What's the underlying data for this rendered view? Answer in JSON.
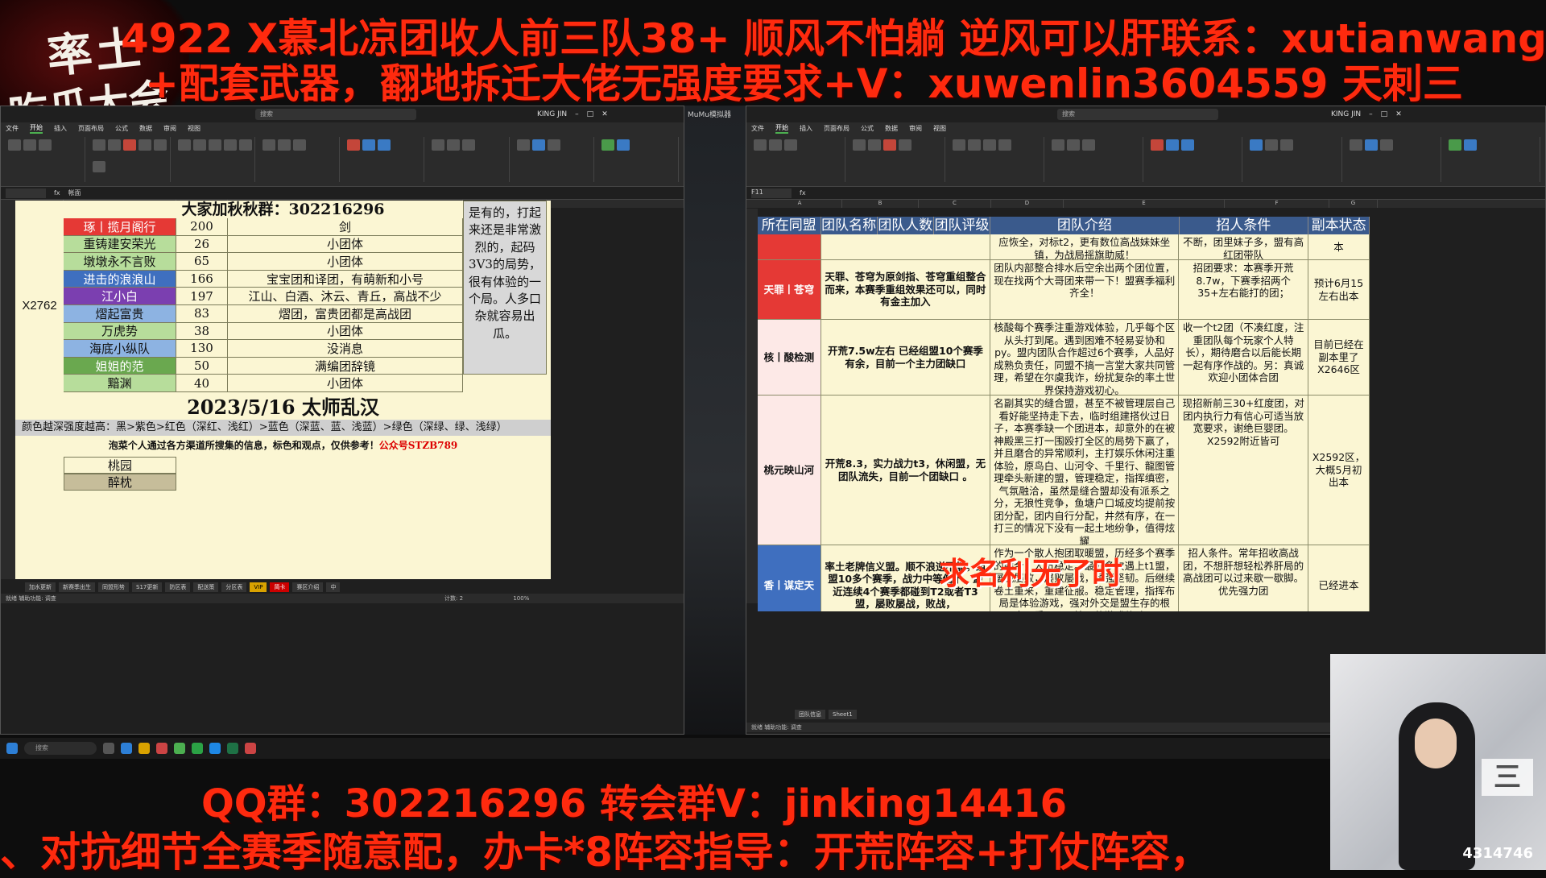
{
  "banners": {
    "top1": "4922 X慕北凉团收人前三队38+ 顺风不怕躺 逆风可以肝联系：xutianwang0",
    "top2": "+配套武器，翻地拆迁大佬无强度要求+V：xuwenlin3604559 天刺三",
    "bottom1": "QQ群：302216296 转会群V：jinking14416",
    "bottom2": "、对抗细节全赛季随意配，办卡*8阵容指导：开荒阵容+打仗阵容，",
    "logo_line1": "率土",
    "logo_line2": "吃瓜大会"
  },
  "left_window": {
    "search": "搜索",
    "user": "KING JIN",
    "formula": "帐面",
    "title": "大家加秋秋群：302216296",
    "server": "X2762",
    "rows": [
      {
        "name": "琢丨揽月阁行",
        "num": "200",
        "desc": "剑",
        "color": "#e53935",
        "text": "#fff"
      },
      {
        "name": "重铸建安荣光",
        "num": "26",
        "desc": "小团体",
        "color": "#b7dd9b",
        "text": "#111"
      },
      {
        "name": "墩墩永不言败",
        "num": "65",
        "desc": "小团体",
        "color": "#b7dd9b",
        "text": "#111"
      },
      {
        "name": "进击的浪浪山",
        "num": "166",
        "desc": "宝宝团和译团，有萌新和小号",
        "color": "#3f6fbf",
        "text": "#fff"
      },
      {
        "name": "江小白",
        "num": "197",
        "desc": "江山、白酒、沐云、青丘，高战不少",
        "color": "#7b3fb0",
        "text": "#fff"
      },
      {
        "name": "熠起富贵",
        "num": "83",
        "desc": "熠团，富贵团都是高战团",
        "color": "#8db3e2",
        "text": "#111"
      },
      {
        "name": "万虎势",
        "num": "38",
        "desc": "小团体",
        "color": "#b7dd9b",
        "text": "#111"
      },
      {
        "name": "海底小纵队",
        "num": "130",
        "desc": "没消息",
        "color": "#8db3e2",
        "text": "#111"
      },
      {
        "name": "姐姐的范",
        "num": "50",
        "desc": "满编团辞镜",
        "color": "#6aa84f",
        "text": "#fff"
      },
      {
        "name": "黯渊",
        "num": "40",
        "desc": "小团体",
        "color": "#b7dd9b",
        "text": "#111"
      }
    ],
    "note": "是有的，打起来还是非常激烈的，起码3V3的局势，很有体验的一个局。人多口杂就容易出瓜。",
    "date": "2023/5/16 太师乱汉",
    "legend": "颜色越深强度越高：黑>紫色>红色（深红、浅红）>蓝色（深蓝、蓝、浅蓝）>绿色（深绿、绿、浅绿）",
    "info_text": "泡菜个人通过各方渠道所搜集的信息，标色和观点，仅供参考！",
    "info_highlight": "公众号STZB789",
    "picks": [
      "桃园",
      "醉枕"
    ],
    "tabs": [
      "加水更新",
      "新赛季出生",
      "同盟形势",
      "S17更新",
      "防区表",
      "配送策",
      "分区表",
      "VIP",
      "简卡",
      "赛区介绍",
      "中"
    ],
    "status": "就绪  辅助功能: 调查",
    "count": "计数: 2",
    "zoom": "100%"
  },
  "right_window": {
    "search": "搜索",
    "user": "KING JIN",
    "cellref": "F11",
    "headers": [
      "所在同盟",
      "团队名称",
      "团队人数",
      "团队评级",
      "团队介绍",
      "招人条件",
      "副本状态"
    ],
    "rows": [
      {
        "alliance": "",
        "name": "",
        "intro": "应恢全，对标t2，更有数位高战妹妹坐镇，为战局摇旗助威！",
        "cond": "不断，团里妹子多，盟有高红团带队",
        "state": "本",
        "color": "#e53935",
        "h": 32
      },
      {
        "alliance": "天罪丨苍穹",
        "name": "天罪、苍穹为原剑指、苍穹重组整合而来，本赛季重组效果还可以，同时有金主加入",
        "intro": "团队内部整合排水后空余出两个团位置，现在找两个大哥团来带一下！盟赛季福利齐全！",
        "cond": "招团要求：本赛季开荒8.7w，下赛季招两个35+左右能打的团；",
        "state": "预计6月15左右出本",
        "color": "#e53935",
        "h": 74
      },
      {
        "alliance": "核丨酸检测",
        "name": "开荒7.5w左右 已经组盟10个赛季有余，目前一个主力团缺口",
        "intro": "核酸每个赛季注重游戏体验，几乎每个区从头打到尾。遇到困难不轻易妥协和py。盟内团队合作超过6个赛季，人品好成熟负责任，同盟不搞一言堂大家共同管理，希望在尔虞我诈，纷扰复杂的率土世界保持游戏初心。",
        "cond": "收一个t2团（不凑红度，注重团队每个玩家个人特长），期待磨合以后能长期一起有序作战的。另：真诚欢迎小团体合团",
        "state": "目前已经在副本里了X2646区",
        "color": "#fde9e7",
        "h": 94
      },
      {
        "alliance": "桃元映山河",
        "name": "开荒8.3，实力战力t3，休闲盟，无团队流失，目前一个团缺口 。",
        "intro": "名副其实的缝合盟，甚至不被管理层自己看好能坚持走下去，临时组建搭伙过日子，本赛季缺一个团进本，却意外的在被神殿黑三打一围殴打全区的局势下赢了，并且磨合的异常顺利，主打娱乐休闲注重体验，原鸟白、山河令、千里行、龍图管理牵头新建的盟，管理稳定，指挥缜密，气氛融洽，虽然是缝合盟却没有派系之分，无狼性竞争，鱼塘户口城皮均提前按团分配，团内自行分配，井然有序，在一打三的情况下没有一起土地纷争，值得炫耀",
        "cond": "现招新前三30+红度团，对团内执行力有信心可适当放宽要求，谢绝巨婴团。X2592附近皆可",
        "state": "X2592区，大概5月初出本",
        "color": "#fde9e7",
        "h": 186
      },
      {
        "alliance": "香丨谋定天",
        "name": "率土老牌信义盟。顺不浪逆不躺。组盟10多个赛季，战力中等偏下，最近连续4个赛季都碰到T2或者T3盟，屡败屡战，败战，",
        "intro": "作为一个散人抱团取暖盟，历经多个赛季的磨合，人员稳定。最近多次遇上t1盟，屡战屡败，屡败屡战，顽强坚韧。后继续卷土重来，重建征服。稳定管理，指挥布局是体验游戏，强对外交是盟生存的根本。秉承公平管理的游戏体验。",
        "cond": "招人条件。常年招收高战团，不想肝想轻松养肝局的高战团可以过来歇一歇脚。优先强力团",
        "state": "已经进本",
        "color": "#3f6fbf",
        "h": 100
      }
    ],
    "subtitle": "求名利无了时",
    "tabs": [
      "团队信息",
      "Sheet1"
    ],
    "status": "就绪  辅助功能: 调查"
  },
  "mumu": {
    "title": "MuMu模拟器"
  },
  "taskbar": {
    "search": "搜索"
  },
  "cam": {
    "logo": "三",
    "viewers": "4314746"
  }
}
